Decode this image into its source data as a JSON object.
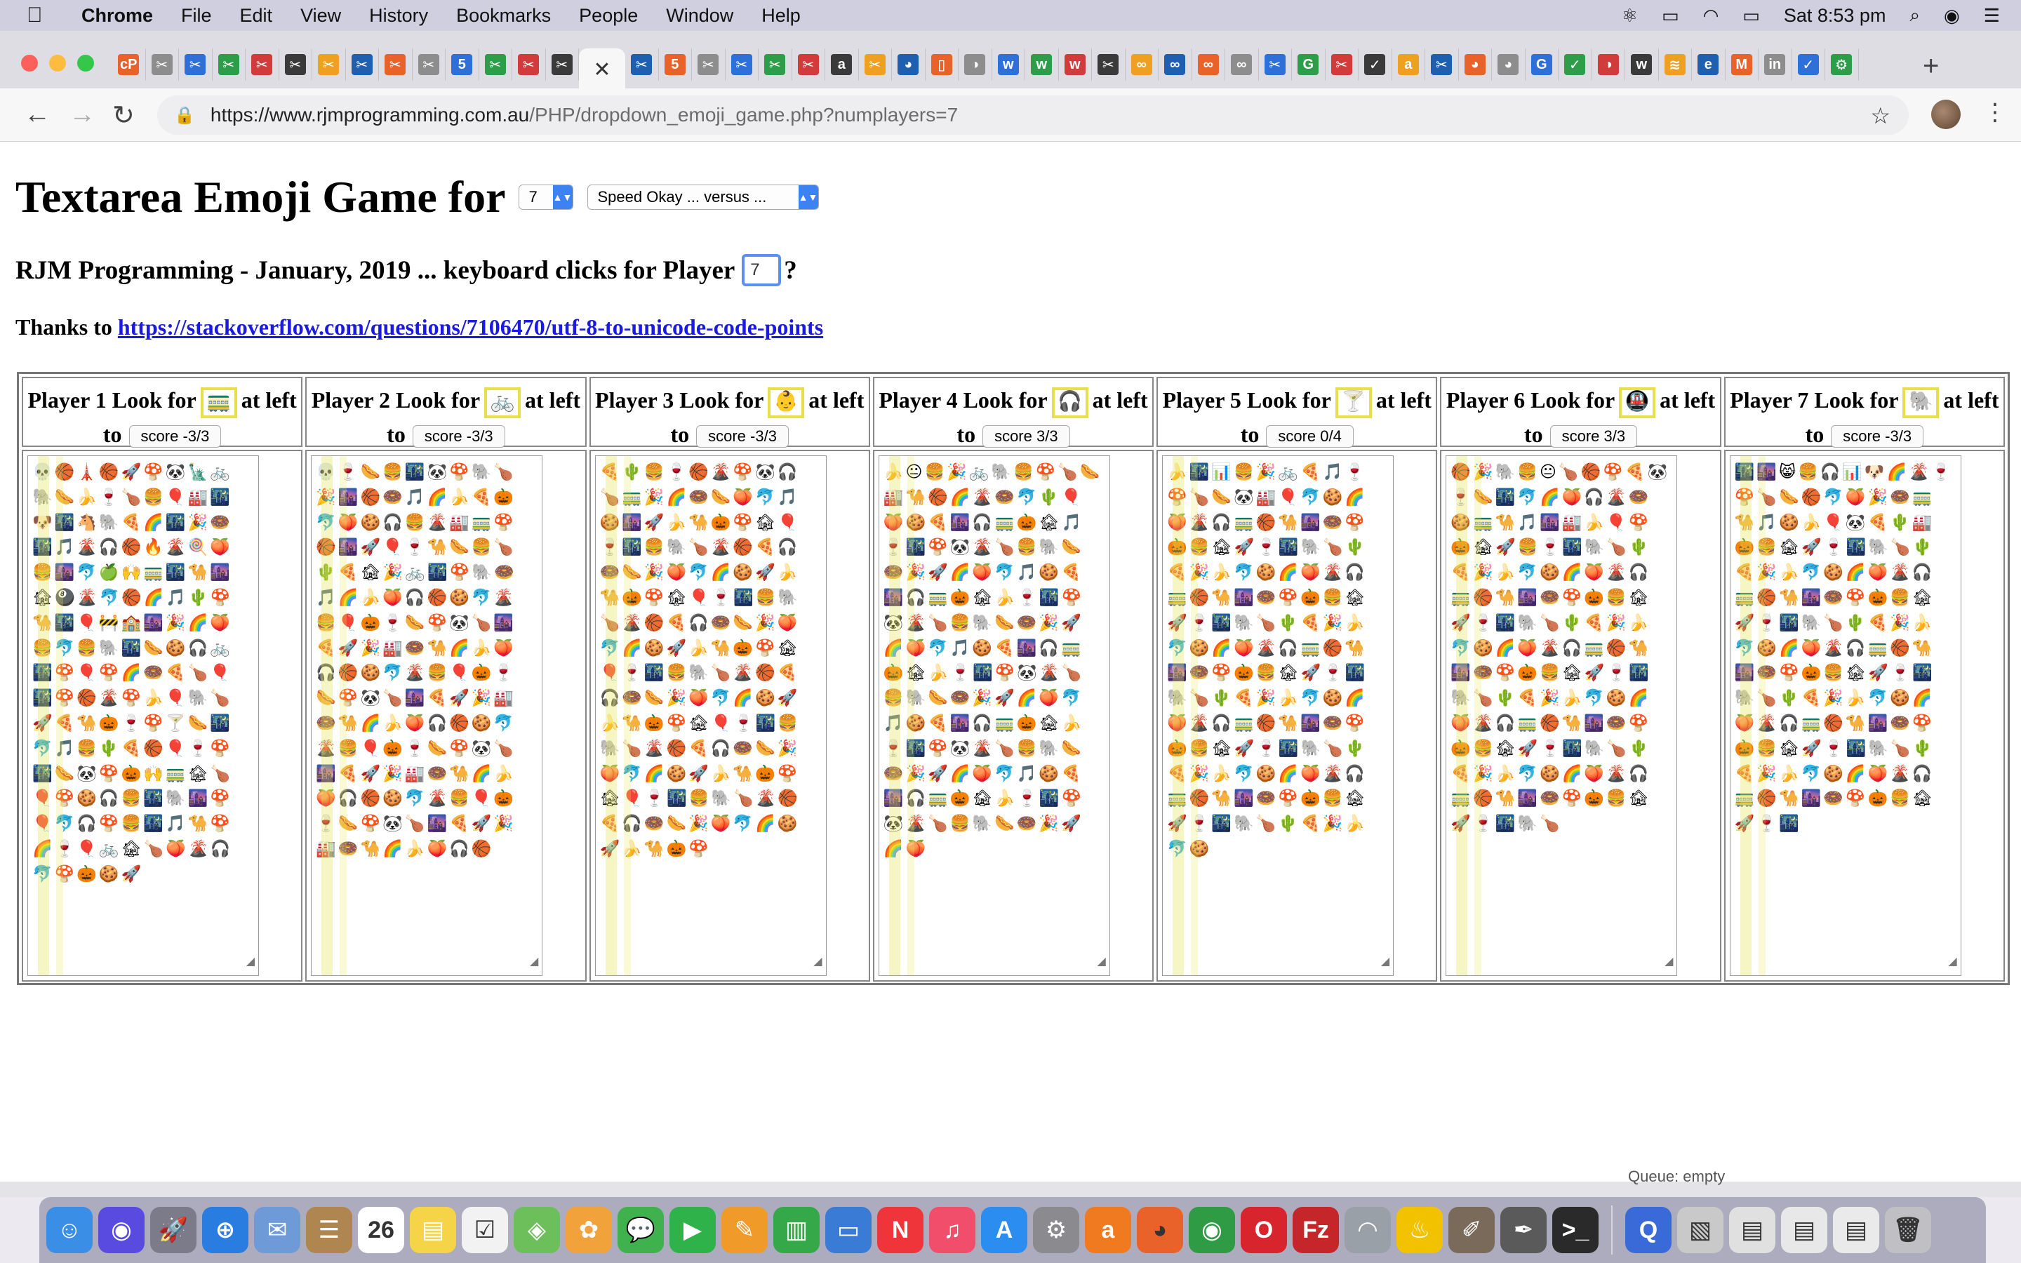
{
  "menubar": {
    "app": "Chrome",
    "items": [
      "File",
      "Edit",
      "View",
      "History",
      "Bookmarks",
      "People",
      "Window",
      "Help"
    ],
    "clock": "Sat 8:53 pm"
  },
  "browser": {
    "url_host": "https://www.rjmprogramming.com.au",
    "url_path": "/PHP/dropdown_emoji_game.php?numplayers=7",
    "tab_favicons": [
      "cP",
      "✂",
      "✂",
      "✂",
      "✂",
      "✂",
      "✂",
      "✂",
      "✂",
      "✂",
      "5",
      "✂",
      "✂",
      "✂",
      "✕",
      "✂",
      "5",
      "✂",
      "✂",
      "✂",
      "✂",
      "a",
      "✂",
      "◕",
      "▯",
      "◑",
      "w",
      "w",
      "w",
      "✂",
      "∞",
      "∞",
      "∞",
      "∞",
      "✂",
      "G",
      "✂",
      "✓",
      "a",
      "✂",
      "◕",
      "◕",
      "G",
      "✓",
      "◑",
      "w",
      "≋",
      "e",
      "M",
      "in",
      "✓",
      "⚙"
    ]
  },
  "page": {
    "title": "Textarea Emoji Game for",
    "num_players": "7",
    "speed_option": "Speed Okay ... versus ...",
    "subtitle": "RJM Programming - January, 2019 ... keyboard clicks for Player",
    "player_value": "7",
    "subtitle_end": "?",
    "thanks_prefix": "Thanks to",
    "thanks_link": "https://stackoverflow.com/questions/7106470/utf-8-to-unicode-code-points"
  },
  "players": [
    {
      "label": "Player 1 Look for",
      "target": "🚃",
      "suffix": "at left",
      "to": "to",
      "score": "score -3/3"
    },
    {
      "label": "Player 2 Look for",
      "target": "🚲",
      "suffix": "at left",
      "to": "to",
      "score": "score -3/3"
    },
    {
      "label": "Player 3 Look for",
      "target": "👶",
      "suffix": "at left",
      "to": "to",
      "score": "score -3/3"
    },
    {
      "label": "Player 4 Look for",
      "target": "🎧",
      "suffix": "at left",
      "to": "to",
      "score": "score 3/3"
    },
    {
      "label": "Player 5 Look for",
      "target": "🍸",
      "suffix": "at left",
      "to": "to",
      "score": "score 0/4"
    },
    {
      "label": "Player 6 Look for",
      "target": "🚇",
      "suffix": "at left",
      "to": "to",
      "score": "score 3/3"
    },
    {
      "label": "Player 7 Look for",
      "target": "🐘",
      "suffix": "at left",
      "to": "to",
      "score": "score -3/3"
    }
  ],
  "emoji_text": [
    "💀🏀🗼🏀🚀🍄🐼🗽🚲🐘🌭🍌🍷🍗🍔🎈🏭🌃🐶🌃🐴🐘🍕🌈🌃🎉🍩🌃🎵🌋🎧🏀🔥🌋🍭🍑🍔🌆🐬🍏🙌🚃🌃🐪🌆🏚🎱🌋🐬🏀🌈🎵🌵🍄🐪🌃🎈🚧🏫🌆🎉🌈🍑🍔🐬🍔🐘🌃🌭🍪🎧🚲🌃🍄🎈🍄🌈🍩🍕🍗🎈🌃🍄🏀🌋🍄🍌🎈🐘🍗🚀🍕🐪🎃🍷🍄🍸🌭🌃🐬🎵🍔🌵🍕🏀🎈🍷🍄🌃🌭🐼🍄🎃🙌🚃🏚🍗🎈🍄🍪🎧🍔🌃🐘🌆🍄🎈🐬🎧🍄🍔🌃🎵🐪🍄🌈🍷🎈🚲🏚🍗🍑🌋🎧🐬🍄🎃🍪🚀",
    "💀🍷🌭🍔🌃🐼🍄🐘🍗🎉🌆🏀🍩🎵🌈🍌🍕🎃🐬🍑🍪🎧🍔🌋🏭🚃🍄🏀🌆🚀🎈🍷🐪🌭🍔🍗🌵🍕🏚🎉🚲🌃🍄🐘🍩🎵🌈🍌🍑🎧🏀🍪🐬🌋🍔🎈🎃🍷🌭🍄🐼🍗🌆🍕🚀🎉🏭🍩🐪🌈🍌🍑🎧🏀🍪🐬🌋🍔🎈🎃🍷🌭🍄🐼🍗🌆🍕🚀🎉🏭🍩🐪🌈🍌🍑🎧🏀🍪🐬🌋🍔🎈🎃🍷🌭🍄🐼🍗🌆🍕🚀🎉🏭🍩🐪🌈🍌🍑🎧🏀🍪🐬🌋🍔🎈🎃🍷🌭🍄🐼🍗🌆🍕🚀🎉🏭🍩🐪🌈🍌🍑🎧🏀",
    "🍕🌵🍔🍷🏀🌋🍄🐼🎧🍗🚃🎉🌈🍩🌭🍑🐬🎵🍪🌆🚀🍌🐪🎃🍄🏚🎈🍷🌃🍔🐘🍗🌋🏀🍕🎧🍩🌭🎉🍑🐬🌈🍪🚀🍌🐪🎃🍄🏚🎈🍷🌃🍔🐘🍗🌋🏀🍕🎧🍩🌭🎉🍑🐬🌈🍪🚀🍌🐪🎃🍄🏚🎈🍷🌃🍔🐘🍗🌋🏀🍕🎧🍩🌭🎉🍑🐬🌈🍪🚀🍌🐪🎃🍄🏚🎈🍷🌃🍔🐘🍗🌋🏀🍕🎧🍩🌭🎉🍑🐬🌈🍪🚀🍌🐪🎃🍄🏚🎈🍷🌃🍔🐘🍗🌋🏀🍕🎧🍩🌭🎉🍑🐬🌈🍪🚀🍌🐪🎃🍄",
    "🍌😐🍔🎉🚲🐘🍔🍄🍗🌭🏭🐪🏀🌈🌋🍩🐬🌵🎈🍑🍪🍕🌆🎧🚃🎃🏚🎵🍷🌃🍄🐼🌋🍗🍔🐘🌭🍩🎉🚀🌈🍑🐬🎵🍪🍕🌆🎧🚃🎃🏚🍌🍷🌃🍄🐼🌋🍗🍔🐘🌭🍩🎉🚀🌈🍑🐬🎵🍪🍕🌆🎧🚃🎃🏚🍌🍷🌃🍄🐼🌋🍗🍔🐘🌭🍩🎉🚀🌈🍑🐬🎵🍪🍕🌆🎧🚃🎃🏚🍌🍷🌃🍄🐼🌋🍗🍔🐘🌭🍩🎉🚀🌈🍑🐬🎵🍪🍕🌆🎧🚃🎃🏚🍌🍷🌃🍄🐼🌋🍗🍔🐘🌭🍩🎉🚀🌈🍑",
    "🍌🌃📊🍔🎉🚲🍕🎵🍷🍄🍗🌭🐼🏭🎈🐬🍪🌈🍑🌋🎧🚃🏀🐪🌆🍩🍄🎃🍔🏚🚀🍷🌃🐘🍗🌵🍕🎉🍌🐬🍪🌈🍑🌋🎧🚃🏀🐪🌆🍩🍄🎃🍔🏚🚀🍷🌃🐘🍗🌵🍕🎉🍌🐬🍪🌈🍑🌋🎧🚃🏀🐪🌆🍩🍄🎃🍔🏚🚀🍷🌃🐘🍗🌵🍕🎉🍌🐬🍪🌈🍑🌋🎧🚃🏀🐪🌆🍩🍄🎃🍔🏚🚀🍷🌃🐘🍗🌵🍕🎉🍌🐬🍪🌈🍑🌋🎧🚃🏀🐪🌆🍩🍄🎃🍔🏚🚀🍷🌃🐘🍗🌵🍕🎉🍌🐬🍪",
    "🏀🎉🐘🍔😐🍗🏀🍄🍕🐼🍷🌭🌃🐬🌈🍑🎧🌋🍩🍪🚃🐪🎵🌆🏭🍌🎈🍄🎃🏚🚀🍔🍷🌃🐘🍗🌵🍕🎉🍌🐬🍪🌈🍑🌋🎧🚃🏀🐪🌆🍩🍄🎃🍔🏚🚀🍷🌃🐘🍗🌵🍕🎉🍌🐬🍪🌈🍑🌋🎧🚃🏀🐪🌆🍩🍄🎃🍔🏚🚀🍷🌃🐘🍗🌵🍕🎉🍌🐬🍪🌈🍑🌋🎧🚃🏀🐪🌆🍩🍄🎃🍔🏚🚀🍷🌃🐘🍗🌵🍕🎉🍌🐬🍪🌈🍑🌋🎧🚃🏀🐪🌆🍩🍄🎃🍔🏚🚀🍷🌃🐘🍗",
    "🌃🌆😸🍔🎧📊🐶🌈🌋🍷🍄🍗🌭🏀🐬🍑🎉🍩🚃🐪🎵🍪🍌🎈🐼🍕🌵🏭🎃🍔🏚🚀🍷🌃🐘🍗🌵🍕🎉🍌🐬🍪🌈🍑🌋🎧🚃🏀🐪🌆🍩🍄🎃🍔🏚🚀🍷🌃🐘🍗🌵🍕🎉🍌🐬🍪🌈🍑🌋🎧🚃🏀🐪🌆🍩🍄🎃🍔🏚🚀🍷🌃🐘🍗🌵🍕🎉🍌🐬🍪🌈🍑🌋🎧🚃🏀🐪🌆🍩🍄🎃🍔🏚🚀🍷🌃🐘🍗🌵🍕🎉🍌🐬🍪🌈🍑🌋🎧🚃🏀🐪🌆🍩🍄🎃🍔🏚🚀🍷🌃"
  ],
  "status": {
    "queue": "Queue: empty"
  },
  "dock": {
    "icons": [
      {
        "name": "finder",
        "glyph": "☺",
        "color": "#3a8ee6"
      },
      {
        "name": "siri",
        "glyph": "◉",
        "color": "#5a4be0"
      },
      {
        "name": "launchpad",
        "glyph": "🚀",
        "color": "#7b7b8a"
      },
      {
        "name": "safari",
        "glyph": "⊕",
        "color": "#2a7de0"
      },
      {
        "name": "mail-bird",
        "glyph": "✉",
        "color": "#6f9ad8"
      },
      {
        "name": "contacts",
        "glyph": "☰",
        "color": "#b08650"
      },
      {
        "name": "calendar",
        "glyph": "26",
        "color": "#ffffff"
      },
      {
        "name": "notes",
        "glyph": "▤",
        "color": "#f5d547"
      },
      {
        "name": "reminders",
        "glyph": "☑",
        "color": "#f2f2f2"
      },
      {
        "name": "maps",
        "glyph": "◈",
        "color": "#6cbf5a"
      },
      {
        "name": "photos",
        "glyph": "✿",
        "color": "#f2a23a"
      },
      {
        "name": "messages",
        "glyph": "💬",
        "color": "#3fb24d"
      },
      {
        "name": "facetime",
        "glyph": "▶",
        "color": "#2fb24a"
      },
      {
        "name": "pages",
        "glyph": "✎",
        "color": "#f09a2a"
      },
      {
        "name": "numbers",
        "glyph": "▥",
        "color": "#35a84a"
      },
      {
        "name": "keynote",
        "glyph": "▭",
        "color": "#3a7bd5"
      },
      {
        "name": "news",
        "glyph": "N",
        "color": "#f0353a"
      },
      {
        "name": "music",
        "glyph": "♫",
        "color": "#f04e6b"
      },
      {
        "name": "app-store",
        "glyph": "A",
        "color": "#2b8df0"
      },
      {
        "name": "system-preferences",
        "glyph": "⚙",
        "color": "#8a8a8f"
      },
      {
        "name": "avast",
        "glyph": "a",
        "color": "#f07a20"
      },
      {
        "name": "firefox",
        "glyph": "◕",
        "color": "#e8622a"
      },
      {
        "name": "chrome",
        "glyph": "◉",
        "color": "#2f9b45"
      },
      {
        "name": "opera",
        "glyph": "O",
        "color": "#d8242c"
      },
      {
        "name": "filezilla",
        "glyph": "Fz",
        "color": "#c4262a"
      },
      {
        "name": "sequel",
        "glyph": "◠",
        "color": "#9aa0a8"
      },
      {
        "name": "cyberduck",
        "glyph": "♨",
        "color": "#f2c200"
      },
      {
        "name": "gimp",
        "glyph": "✐",
        "color": "#7a6a5a"
      },
      {
        "name": "inkscape",
        "glyph": "✒",
        "color": "#5a5a5a"
      },
      {
        "name": "terminal",
        "glyph": ">_",
        "color": "#2a2a2a"
      },
      {
        "name": "quicktime",
        "glyph": "Q",
        "color": "#3a6ad8"
      },
      {
        "name": "preview",
        "glyph": "▧",
        "color": "#c9c9c9"
      },
      {
        "name": "document-1",
        "glyph": "▤",
        "color": "#e0e0e0"
      },
      {
        "name": "document-2",
        "glyph": "▤",
        "color": "#e8e8e8"
      },
      {
        "name": "document-3",
        "glyph": "▤",
        "color": "#eaeaea"
      },
      {
        "name": "trash",
        "glyph": "🗑",
        "color": "#bfbfc4"
      }
    ]
  }
}
